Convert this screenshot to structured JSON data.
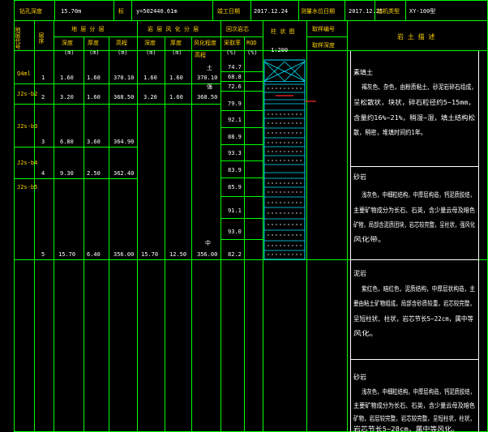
{
  "header": {
    "depth_label": "钻孔深度",
    "depth_value": "15.70m",
    "coord_label": "标",
    "coord_value": "y=502440.61m",
    "date_label": "竣工日期",
    "date_value": "2017.12.24",
    "water_label": "测量水位日期",
    "water_value": "2017.12.25",
    "rig_label": "钻机类型",
    "rig_value": "XY-100型"
  },
  "columns": {
    "code": "地层代号",
    "seq": "层序",
    "layer_group": "地 层 分 层",
    "depth": "深度",
    "thick": "厚度",
    "elev": "高程",
    "weather_group": "岩 层 风 化 分 层",
    "w_depth": "深度",
    "w_thick": "厚度",
    "w_grade": "风化程度",
    "w_elev": "高程",
    "unit_m": "(m)",
    "core_group": "回次岩芯",
    "core_rate": "采取率",
    "rqd": "RQD",
    "pct": "(%)",
    "column": "柱 状 图",
    "scale": "1:200",
    "sample_group": "取样编号",
    "sample_depth": "取样深度",
    "desc": "岩 土 描 述"
  },
  "rows": [
    {
      "code": "Q4ml",
      "seq": "1",
      "depth": "1.60",
      "thick": "1.60",
      "elev": "370.10",
      "w_depth": "1.60",
      "w_thick": "1.60",
      "w_grade": "土",
      "w_elev": "370.10"
    },
    {
      "code": "J2s-b2",
      "seq": "2",
      "depth": "3.20",
      "thick": "1.60",
      "elev": "368.50",
      "w_depth": "3.20",
      "w_thick": "1.60",
      "w_grade": "强",
      "w_elev": "368.50"
    },
    {
      "code": "J2s-b3",
      "seq": "3",
      "depth": "6.80",
      "thick": "3.60",
      "elev": "364.90",
      "w_depth": "",
      "w_thick": "",
      "w_grade": "",
      "w_elev": ""
    },
    {
      "code": "J2s-b4",
      "seq": "4",
      "depth": "9.30",
      "thick": "2.50",
      "elev": "362.40",
      "w_depth": "",
      "w_thick": "",
      "w_grade": "",
      "w_elev": ""
    },
    {
      "code": "J2s-b5",
      "seq": "5",
      "depth": "15.70",
      "thick": "6.40",
      "elev": "356.00",
      "w_depth": "15.70",
      "w_thick": "12.50",
      "w_grade": "中",
      "w_elev": "356.00"
    }
  ],
  "core_rates": [
    "74.7",
    "68.8",
    "72.6",
    "79.9",
    "92.1",
    "88.9",
    "93.3",
    "83.9",
    "85.9",
    "91.1",
    "93.0",
    "82.2"
  ],
  "descriptions": [
    {
      "title": "素填土",
      "lines": [
        "褐灰色、杂色，由粉质粘土、砂泥岩碎石组成，",
        "呈松散状，块状，碎石粒径约5~15mm，",
        "含量约16%~21%，稍湿~湿，填土结构松",
        "散，稍密，堆填时间约1年。"
      ]
    },
    {
      "title": "砂岩",
      "lines": [
        "浅灰色，中细粒结构，中厚层构造，钙泥质胶结，",
        "主要矿物成分为长石、石英，含少量云母及暗色",
        "矿物，局部含泥质团块，岩芯较完整，呈柱状，强风化",
        "风化带。"
      ]
    },
    {
      "title": "泥岩",
      "lines": [
        "紫红色，暗红色，泥质结构，中厚层状构造，主",
        "要由粘土矿物组成，局部含砂质较重，岩芯较完整，",
        "呈短柱状、柱状，岩芯节长5~22cm，属中等",
        "风化。"
      ]
    },
    {
      "title": "砂岩",
      "lines": [
        "浅灰色，中细粒结构，中厚层构造，钙泥质胶结，",
        "主要矿物成分为长石、石英，含少量云母及暗色",
        "矿物，岩层较完整，岩芯较完整，呈短柱状，柱状，",
        "岩芯节长5~28cm，属中等风化。"
      ]
    }
  ],
  "colors": {
    "grid": "#00ff00",
    "cyan": "#00e5ff",
    "yellow": "#ffd400",
    "white": "#ffffff",
    "red": "#ff2a2a"
  }
}
